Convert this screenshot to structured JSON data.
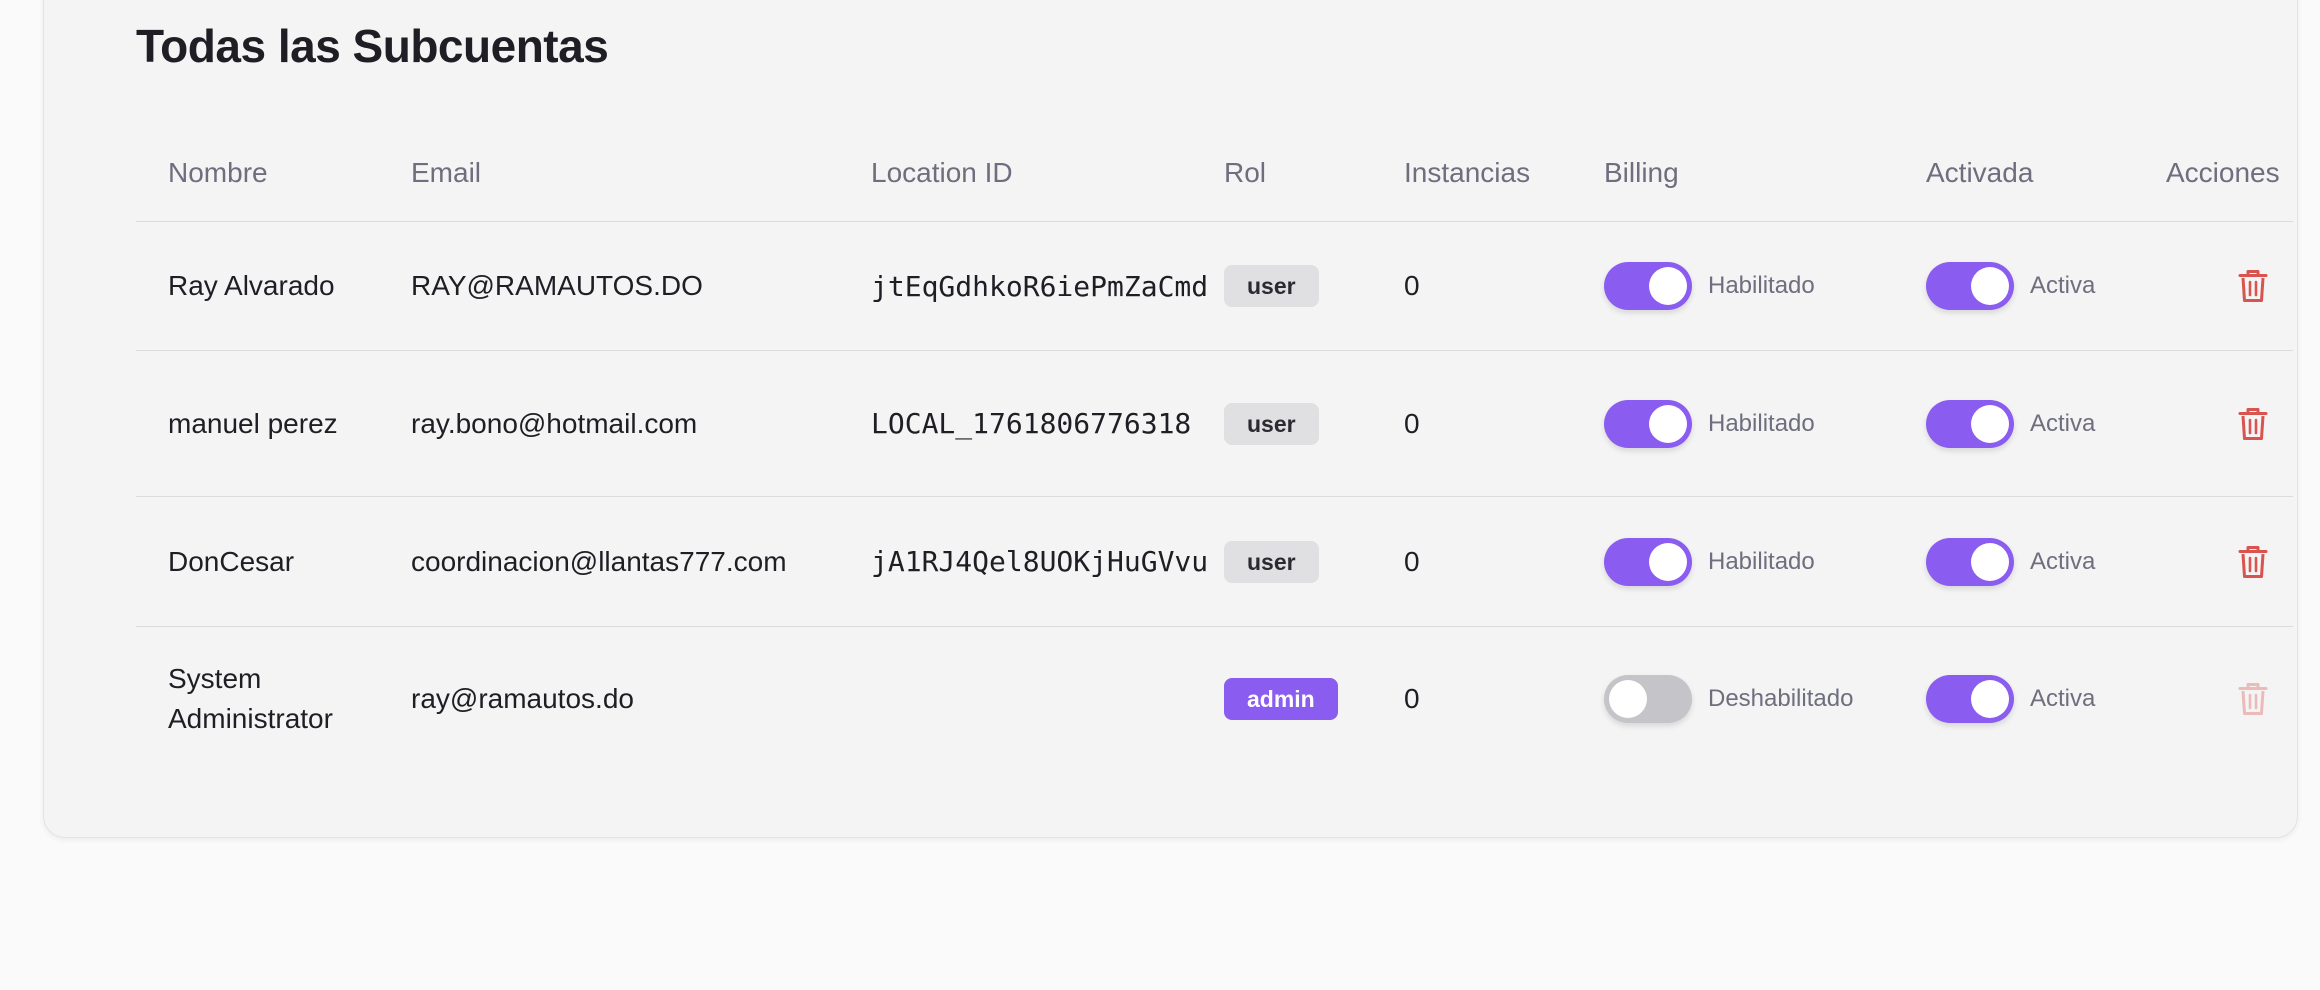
{
  "page": {
    "title": "Todas las Subcuentas"
  },
  "table": {
    "headers": {
      "name": "Nombre",
      "email": "Email",
      "location_id": "Location ID",
      "role": "Rol",
      "instances": "Instancias",
      "billing": "Billing",
      "activated": "Activada",
      "actions": "Acciones"
    },
    "rows": [
      {
        "name": "Ray Alvarado",
        "email": "RAY@RAMAUTOS.DO",
        "location_id": "jtEqGdhkoR6iePmZaCmd",
        "role": "user",
        "instances": "0",
        "billing_on": true,
        "billing_label": "Habilitado",
        "active_on": true,
        "active_label": "Activa",
        "delete_enabled": true
      },
      {
        "name": "manuel perez",
        "email": "ray.bono@hotmail.com",
        "location_id": "LOCAL_1761806776318",
        "role": "user",
        "instances": "0",
        "billing_on": true,
        "billing_label": "Habilitado",
        "active_on": true,
        "active_label": "Activa",
        "delete_enabled": true
      },
      {
        "name": "DonCesar",
        "email": "coordinacion@llantas777.com",
        "location_id": "jA1RJ4Qel8UOKjHuGVvu",
        "role": "user",
        "instances": "0",
        "billing_on": true,
        "billing_label": "Habilitado",
        "active_on": true,
        "active_label": "Activa",
        "delete_enabled": true
      },
      {
        "name": "System Administrator",
        "email": "ray@ramautos.do",
        "location_id": "",
        "role": "admin",
        "instances": "0",
        "billing_on": false,
        "billing_label": "Deshabilitado",
        "active_on": true,
        "active_label": "Activa",
        "delete_enabled": false
      }
    ]
  },
  "colors": {
    "accent": "#8a5cf0",
    "toggle_off": "#c4c4c9",
    "danger": "#d9534f",
    "badge_user_bg": "#e0e0e3"
  },
  "icons": {
    "delete": "trash-icon"
  }
}
